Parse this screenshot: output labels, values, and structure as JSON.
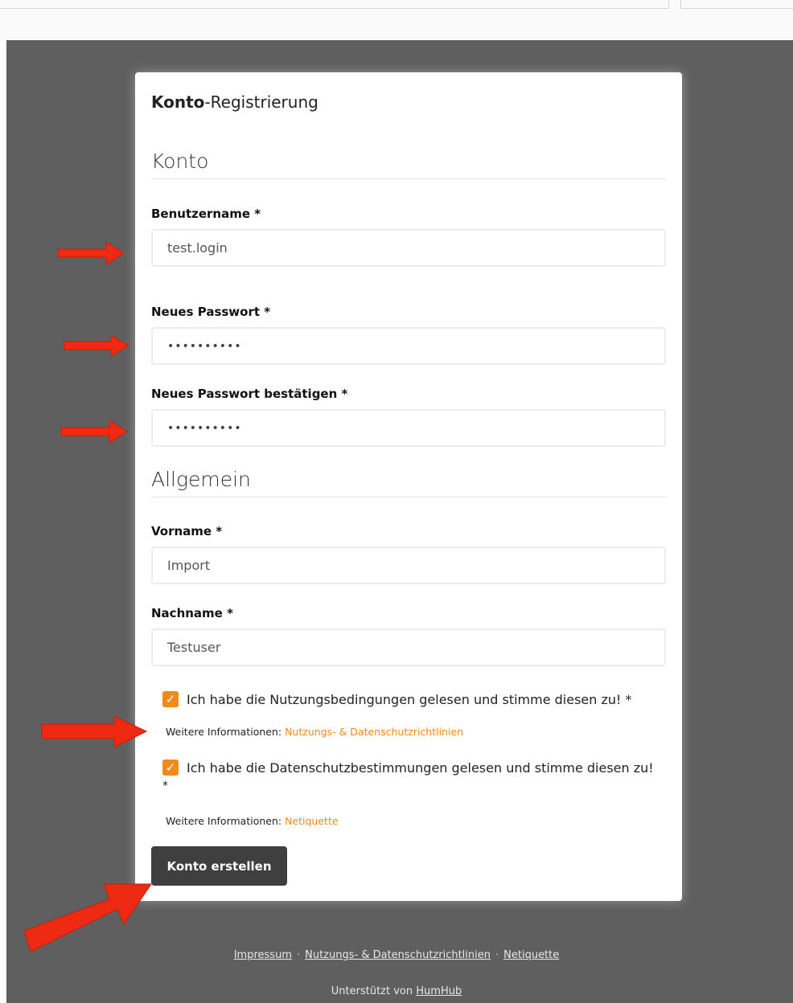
{
  "form": {
    "title_bold": "Konto",
    "title_rest": "-Registrierung",
    "section_account": "Konto",
    "section_general": "Allgemein",
    "username": {
      "label": "Benutzername *",
      "value": "test.login"
    },
    "password": {
      "label": "Neues Passwort *",
      "value": "••••••••••"
    },
    "password_confirm": {
      "label": "Neues Passwort bestätigen *",
      "value": "••••••••••"
    },
    "firstname": {
      "label": "Vorname *",
      "value": "Import"
    },
    "lastname": {
      "label": "Nachname *",
      "value": "Testuser"
    },
    "terms_checkbox": {
      "checked": true,
      "text": "Ich habe die Nutzungsbedingungen gelesen und stimme diesen zu! *"
    },
    "terms_info": {
      "prefix": "Weitere Informationen:",
      "link": "Nutzungs- & Datenschutzrichtlinien"
    },
    "privacy_checkbox": {
      "checked": true,
      "text": "Ich habe die Datenschutzbestimmungen gelesen und stimme diesen zu!",
      "star": "*"
    },
    "privacy_info": {
      "prefix": "Weitere Informationen:",
      "link": "Netiquette"
    },
    "submit_label": "Konto erstellen",
    "check_glyph": "✓"
  },
  "footer": {
    "links": [
      "Impressum",
      "Nutzungs- & Datenschutzrichtlinien",
      "Netiquette"
    ],
    "separator": "·",
    "powered_prefix": "Unterstützt von",
    "powered_link": "HumHub"
  },
  "colors": {
    "accent": "#ef8a1b",
    "annotation_arrow": "#ee2a12",
    "backdrop": "#5f5f5f",
    "button": "#3f3f3f"
  },
  "annotations": {
    "arrow_icon": "red-arrow-icon"
  }
}
